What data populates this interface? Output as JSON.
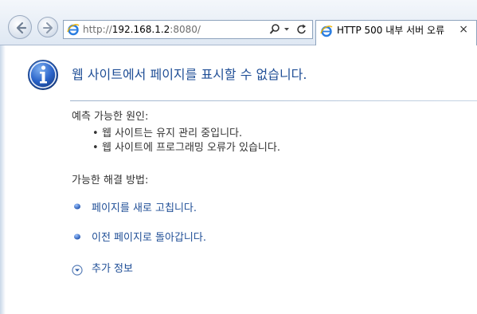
{
  "browser": {
    "address": {
      "scheme": "http://",
      "host": "192.168.1.2",
      "rest": ":8080/"
    },
    "tab": {
      "title": "HTTP 500 내부 서버 오류",
      "close_symbol": "×"
    },
    "icons": {
      "back": "back-arrow-icon",
      "forward": "forward-arrow-icon",
      "site": "ie-logo-icon",
      "search": "search-icon",
      "dropdown": "chevron-down-icon",
      "refresh": "refresh-icon",
      "close": "close-icon"
    }
  },
  "page": {
    "title": "웹 사이트에서 페이지를 표시할 수 없습니다.",
    "icon": "info-icon",
    "causes": {
      "heading": "예측 가능한 원인:",
      "items": [
        "웹 사이트는 유지 관리 중입니다.",
        "웹 사이트에 프로그래밍 오류가 있습니다."
      ]
    },
    "solutions": {
      "heading": "가능한 해결 방법:",
      "items": [
        "페이지를 새로 고칩니다.",
        "이전 페이지로 돌아갑니다."
      ]
    },
    "more_info": "추가 정보"
  },
  "colors": {
    "title": "#1f4e96",
    "link": "#1f4e96",
    "text": "#333333",
    "bullet": "#2f62b8"
  }
}
